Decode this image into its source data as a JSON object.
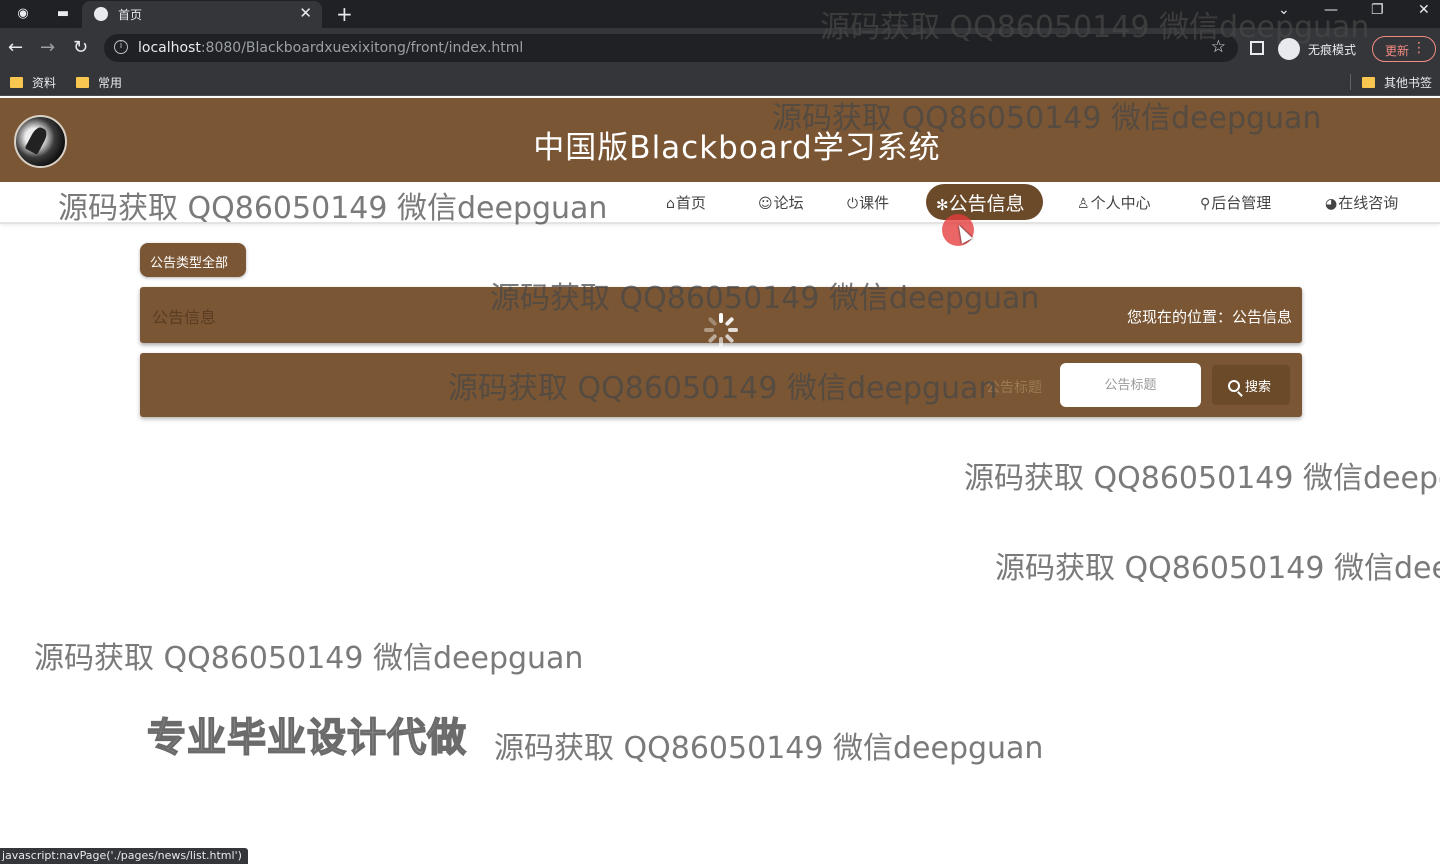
{
  "browser": {
    "tab_title": "首页",
    "url_host": "localhost",
    "url_rest": ":8080/Blackboardxuexixitong/front/index.html",
    "profile_label": "无痕模式",
    "update_label": "更新",
    "bookmarks": [
      "资料",
      "常用"
    ],
    "other_bookmarks": "其他书签",
    "status_url": "javascript:navPage('./pages/news/list.html')"
  },
  "site": {
    "title": "中国版Blackboard学习系统",
    "nav": [
      {
        "icon": "⌂",
        "label": "首页"
      },
      {
        "icon": "☺",
        "label": "论坛"
      },
      {
        "icon": "⏻",
        "label": "课件"
      },
      {
        "icon": "✻",
        "label": "公告信息"
      },
      {
        "icon": "♙",
        "label": "个人中心"
      },
      {
        "icon": "⚲",
        "label": "后台管理"
      },
      {
        "icon": "◕",
        "label": "在线咨询"
      }
    ],
    "active_nav": "公告信息"
  },
  "filters": {
    "type_button": "公告类型全部"
  },
  "breadcrumb": {
    "title": "公告信息",
    "location_label": "您现在的位置：公告信息"
  },
  "search": {
    "label": "公告标题",
    "placeholder": "公告标题",
    "button_label": "搜索"
  },
  "overlay": {
    "watermark": "源码获取 QQ86050149 微信deepguan",
    "promo": "专业毕业设计代做"
  },
  "colors": {
    "header_brown": "#7a5634",
    "active_nav_bg": "#6b4a2a"
  }
}
